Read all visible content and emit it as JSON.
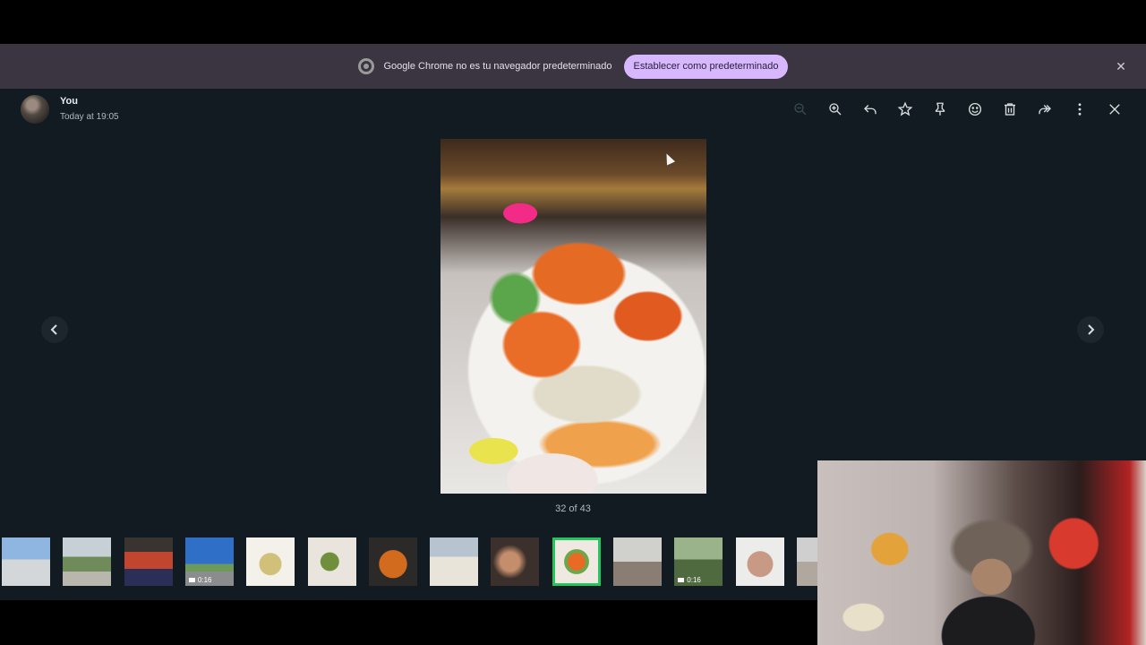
{
  "infobar": {
    "message": "Google Chrome no es tu navegador predeterminado",
    "button_label": "Establecer como predeterminado",
    "close_icon": "close-icon"
  },
  "header": {
    "sender": "You",
    "time": "Today at 19:05"
  },
  "toolbar": {
    "icons": [
      "zoom-out-icon",
      "zoom-in-icon",
      "reply-icon",
      "star-icon",
      "pin-icon",
      "emoji-icon",
      "delete-icon",
      "forward-icon",
      "menu-icon",
      "close-icon"
    ]
  },
  "counter": "32 of 43",
  "thumbnails": [
    {
      "kind": "photo"
    },
    {
      "kind": "photo"
    },
    {
      "kind": "photo"
    },
    {
      "kind": "video",
      "duration": "0:16"
    },
    {
      "kind": "photo"
    },
    {
      "kind": "photo"
    },
    {
      "kind": "photo"
    },
    {
      "kind": "photo"
    },
    {
      "kind": "photo"
    },
    {
      "kind": "photo",
      "selected": true
    },
    {
      "kind": "photo"
    },
    {
      "kind": "video",
      "duration": "0:16"
    },
    {
      "kind": "photo"
    },
    {
      "kind": "photo"
    }
  ],
  "colors": {
    "viewer_bg": "#111b21",
    "infobar_bg": "#3b3542",
    "infobar_button": "#d7b8ff",
    "selected_border": "#22c55e"
  }
}
